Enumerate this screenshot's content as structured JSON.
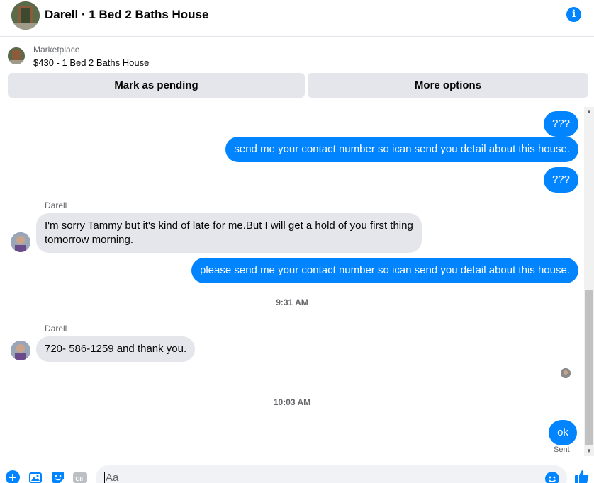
{
  "header": {
    "title": "Darell · 1 Bed 2 Baths House"
  },
  "marketplace": {
    "label": "Marketplace",
    "listing": "$430 - 1 Bed 2 Baths House",
    "mark_pending_label": "Mark as pending",
    "more_options_label": "More options"
  },
  "messages": [
    {
      "from": "me",
      "text": "???"
    },
    {
      "from": "me",
      "text": "send me your contact number so ican send you detail about this house."
    },
    {
      "from": "me",
      "text": "???"
    },
    {
      "from": "Darell",
      "sender": "Darell",
      "lines": [
        "I'm sorry Tammy but it's kind of late for me.But I will get a hold of you first thing",
        "tomorrow morning."
      ]
    },
    {
      "from": "me",
      "text": "please  send me your contact number so ican send you detail about this house."
    },
    {
      "type": "timestamp",
      "text": "9:31 AM"
    },
    {
      "from": "Darell",
      "sender": "Darell",
      "text": "720- 586-1259 and thank you."
    },
    {
      "type": "timestamp",
      "text": "10:03 AM"
    },
    {
      "from": "me",
      "text": "ok",
      "status": "Sent"
    }
  ],
  "composer": {
    "placeholder": "Aa"
  },
  "colors": {
    "accent": "#0084ff",
    "incoming_bubble": "#e4e6eb"
  },
  "icons": [
    "info-icon",
    "plus-icon",
    "photo-icon",
    "sticker-icon",
    "gif-icon",
    "emoji-icon",
    "thumbs-up-icon"
  ]
}
